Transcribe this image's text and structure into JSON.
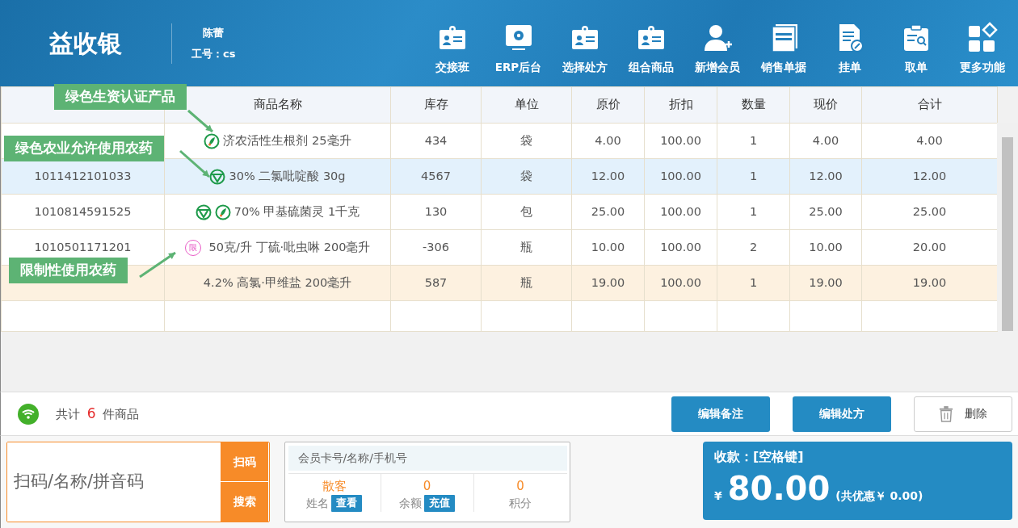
{
  "app": {
    "title": "益收银",
    "user_name": "陈蕾",
    "user_id": "工号：cs"
  },
  "toolbar": [
    {
      "label": "交接班",
      "kind": "id-card"
    },
    {
      "label": "ERP后台",
      "kind": "monitor"
    },
    {
      "label": "选择处方",
      "kind": "id-card"
    },
    {
      "label": "组合商品",
      "kind": "id-card"
    },
    {
      "label": "新增会员",
      "kind": "user-plus"
    },
    {
      "label": "销售单据",
      "kind": "documents"
    },
    {
      "label": "挂单",
      "kind": "doc-edit"
    },
    {
      "label": "取单",
      "kind": "clipboard"
    },
    {
      "label": "更多功能",
      "kind": "grid"
    }
  ],
  "table": {
    "columns": [
      "商品名称",
      "库存",
      "单位",
      "原价",
      "折扣",
      "数量",
      "现价",
      "合计"
    ],
    "rows": [
      {
        "code": "",
        "badges": [
          {
            "kind": "leaf"
          }
        ],
        "name": "济农活性生根剂 25毫升",
        "stock": "434",
        "unit": "袋",
        "price": "4.00",
        "discount": "100.00",
        "qty": "1",
        "current": "4.00",
        "total": "4.00",
        "selected": false,
        "flagged": false
      },
      {
        "code": "1011412101033",
        "badges": [
          {
            "kind": "green-v"
          }
        ],
        "name": "30% 二氯吡啶酸 30g",
        "stock": "4567",
        "unit": "袋",
        "price": "12.00",
        "discount": "100.00",
        "qty": "1",
        "current": "12.00",
        "total": "12.00",
        "selected": true,
        "flagged": false
      },
      {
        "code": "1010814591525",
        "badges": [
          {
            "kind": "green-v"
          },
          {
            "kind": "leaf"
          }
        ],
        "name": "70% 甲基硫菌灵 1千克",
        "stock": "130",
        "unit": "包",
        "price": "25.00",
        "discount": "100.00",
        "qty": "1",
        "current": "25.00",
        "total": "25.00",
        "selected": false,
        "flagged": false
      },
      {
        "code": "1010501171201",
        "badges": [
          {
            "kind": "restricted",
            "text": "限"
          }
        ],
        "name": "50克/升 丁硫·吡虫啉 200毫升",
        "stock": "-306",
        "unit": "瓶",
        "price": "10.00",
        "discount": "100.00",
        "qty": "2",
        "current": "10.00",
        "total": "20.00",
        "selected": false,
        "flagged": false
      },
      {
        "code": "",
        "badges": [],
        "name": "4.2% 高氯·甲维盐 200毫升",
        "stock": "587",
        "unit": "瓶",
        "price": "19.00",
        "discount": "100.00",
        "qty": "1",
        "current": "19.00",
        "total": "19.00",
        "selected": false,
        "flagged": true
      }
    ]
  },
  "callouts": [
    {
      "text": "绿色生资认证产品"
    },
    {
      "text": "绿色农业允许使用农药"
    },
    {
      "text": "限制性使用农药"
    }
  ],
  "status_bar": {
    "count_prefix": "共计",
    "count": "6",
    "count_suffix": "件商品",
    "buttons": [
      {
        "label": "编辑备注",
        "kind": "primary"
      },
      {
        "label": "编辑处方",
        "kind": "primary"
      },
      {
        "label": "删除",
        "kind": "delete"
      }
    ]
  },
  "scan": {
    "placeholder": "扫码/名称/拼音码",
    "buttons": [
      "扫码",
      "搜索"
    ]
  },
  "member": {
    "placeholder": "会员卡号/名称/手机号",
    "stats": [
      {
        "value": "散客",
        "label": "姓名",
        "action": "查看"
      },
      {
        "value": "0",
        "label": "余额",
        "action": "充值"
      },
      {
        "value": "0",
        "label": "积分"
      }
    ]
  },
  "payment": {
    "title": "收款：[空格键]",
    "currency": "¥",
    "amount": "80.00",
    "discount": "(共优惠￥ 0.00)"
  }
}
